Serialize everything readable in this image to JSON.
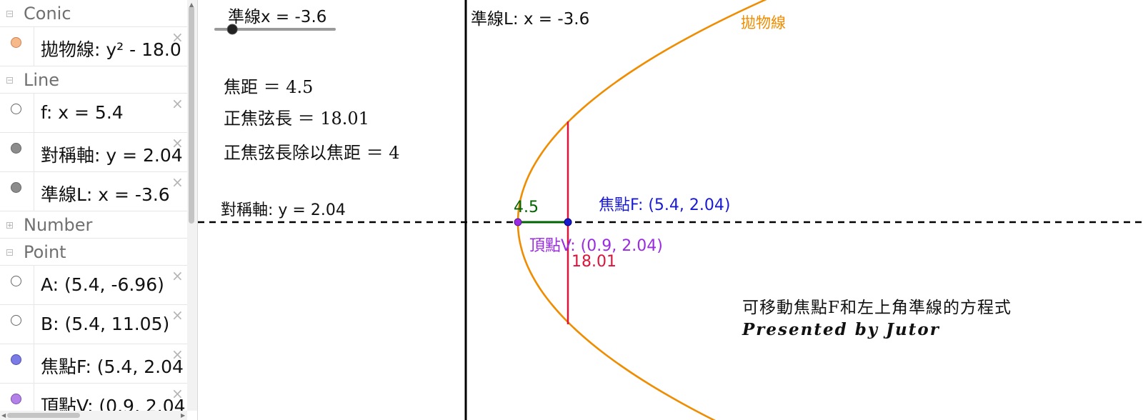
{
  "algebra": {
    "groups": [
      {
        "label": "Conic",
        "toggle": "−",
        "items": [
          {
            "text": "拋物線: y² - 18.0",
            "dot_color": "#f6b98a",
            "close": "×"
          }
        ]
      },
      {
        "label": "Line",
        "toggle": "−",
        "items": [
          {
            "text": "f: x = 5.4",
            "dot_color": "#ffffff",
            "close": "×"
          },
          {
            "text": "對稱軸: y = 2.04",
            "dot_color": "#8c8c8c",
            "close": "×"
          },
          {
            "text": "準線L: x = -3.6",
            "dot_color": "#8c8c8c",
            "close": "×"
          }
        ]
      },
      {
        "label": "Number",
        "toggle": "+",
        "items": []
      },
      {
        "label": "Point",
        "toggle": "−",
        "items": [
          {
            "text": "A: (5.4, -6.96)",
            "dot_color": "#ffffff",
            "close": "×"
          },
          {
            "text": "B: (5.4, 11.05)",
            "dot_color": "#ffffff",
            "close": "×"
          },
          {
            "text": "焦點F: (5.4, 2.04",
            "dot_color": "#7b7be6",
            "close": "×"
          },
          {
            "text": "頂點V: (0.9, 2.04",
            "dot_color": "#b382e8",
            "close": "×"
          }
        ]
      }
    ]
  },
  "graphics": {
    "slider": {
      "label": "準線x = -3.6",
      "value": -3.6,
      "fraction": 0.14
    },
    "directrix_label": "準線L: x = -3.6",
    "parabola_label": "拋物線",
    "focal_distance": "焦距 ＝ 4.5",
    "latus_rectum": "正焦弦長 ＝ 18.01",
    "ratio": "正焦弦長除以焦距 ＝ 4",
    "axis_label": "對稱軸: y = 2.04",
    "segment_vf_label": "4.5",
    "focus_label": "焦點F: (5.4, 2.04)",
    "vertex_label": "頂點V: (0.9, 2.04)",
    "latus_label": "18.01",
    "note_line1": "可移動焦點F和左上角準線的方程式",
    "note_line2": "Presented by Jutor"
  },
  "colors": {
    "parabola": "#f08c00",
    "latus": "#dc143c",
    "segment": "#006400",
    "focus": "#0000cc",
    "vertex": "#9a2be2",
    "axis": "#000000"
  }
}
